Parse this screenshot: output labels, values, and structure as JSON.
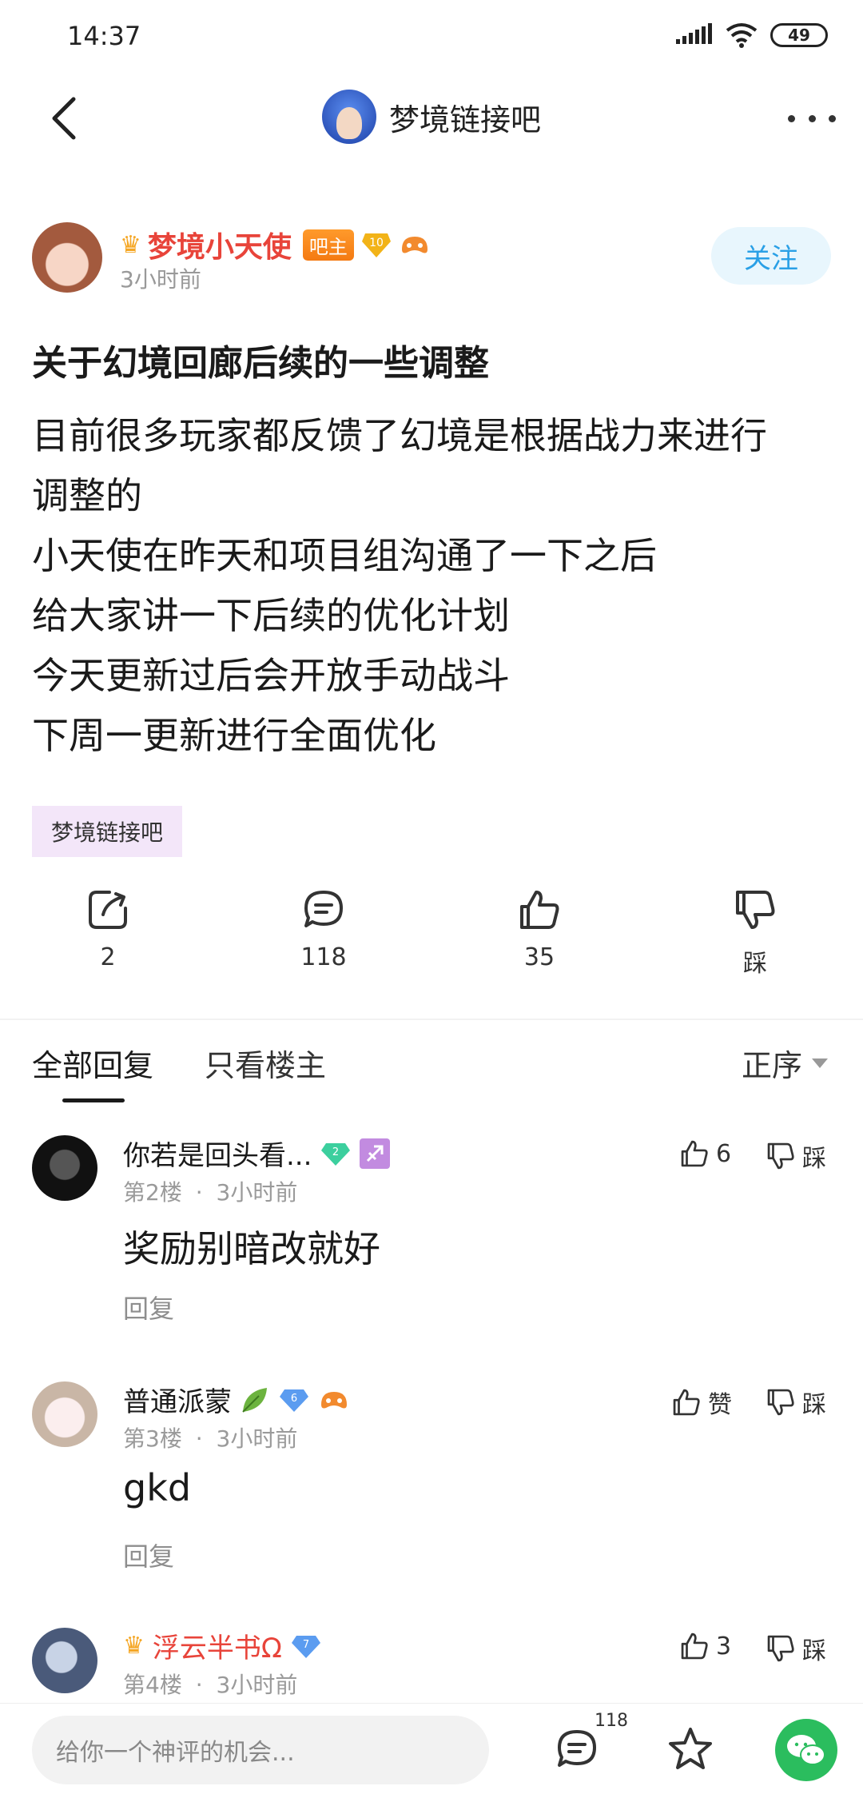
{
  "status": {
    "time": "14:37",
    "battery": "49"
  },
  "nav": {
    "title": "梦境链接吧"
  },
  "post": {
    "author": "梦境小天使",
    "admin_badge": "吧主",
    "level": "10",
    "time": "3小时前",
    "follow_label": "关注",
    "title": "关于幻境回廊后续的一些调整",
    "body_lines": [
      "目前很多玩家都反馈了幻境是根据战力来进行",
      "调整的",
      "小天使在昨天和项目组沟通了一下之后",
      "给大家讲一下后续的优化计划",
      "今天更新过后会开放手动战斗",
      "下周一更新进行全面优化"
    ],
    "tag": "梦境链接吧"
  },
  "actions": {
    "share": "2",
    "comment": "118",
    "like": "35",
    "dislike": "踩"
  },
  "tabs": {
    "all": "全部回复",
    "op_only": "只看楼主",
    "sort": "正序"
  },
  "comments": [
    {
      "name": "你若是回头看...",
      "level": "2",
      "floor": "第2楼",
      "dot": "·",
      "time": "3小时前",
      "text": "奖励别暗改就好",
      "reply": "回复",
      "likes": "6",
      "dislike": "踩"
    },
    {
      "name": "普通派蒙",
      "level": "6",
      "floor": "第3楼",
      "dot": "·",
      "time": "3小时前",
      "text": "gkd",
      "reply": "回复",
      "likes": "赞",
      "dislike": "踩"
    },
    {
      "name": "浮云半书Ω",
      "level": "7",
      "floor": "第4楼",
      "dot": "·",
      "time": "3小时前",
      "likes": "3",
      "dislike": "踩"
    }
  ],
  "bottom": {
    "placeholder": "给你一个神评的机会...",
    "comment_count": "118"
  },
  "colors": {
    "accent_red": "#e8443a",
    "follow_blue": "#2aa0e6",
    "wechat_green": "#2bbd5e"
  }
}
